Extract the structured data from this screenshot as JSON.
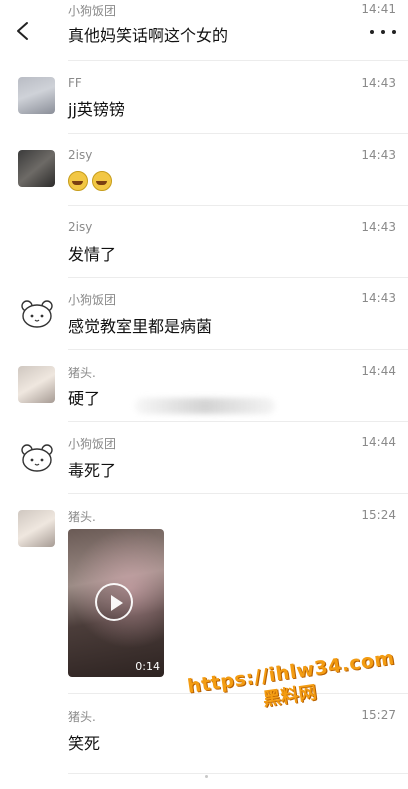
{
  "header": {
    "prev_sender": "小狗饭团",
    "prev_time": "14:41",
    "title": "真他妈笑话啊这个女的"
  },
  "messages": [
    {
      "sender": "FF",
      "time": "14:43",
      "text": "jj英镑镑",
      "avatar": "photo"
    },
    {
      "sender": "2isy",
      "time": "14:43",
      "text": "",
      "emoji": [
        "laugh-cry-emoji",
        "laugh-cry-emoji"
      ],
      "avatar": "photo"
    },
    {
      "sender": "2isy",
      "time": "14:43",
      "text": "发情了",
      "avatar": "none"
    },
    {
      "sender": "小狗饭团",
      "time": "14:43",
      "text": "感觉教室里都是病菌",
      "avatar": "bear"
    },
    {
      "sender": "猪头.",
      "time": "14:44",
      "text": "硬了",
      "avatar": "photo"
    },
    {
      "sender": "小狗饭团",
      "time": "14:44",
      "text": "毒死了",
      "avatar": "bear"
    },
    {
      "sender": "猪头.",
      "time": "15:24",
      "video_duration": "0:14",
      "avatar": "photo"
    },
    {
      "sender": "猪头.",
      "time": "15:27",
      "text": "笑死",
      "avatar": "none"
    }
  ],
  "watermark": {
    "line1": "https://ihlw34.com",
    "line2": "黑料网"
  }
}
